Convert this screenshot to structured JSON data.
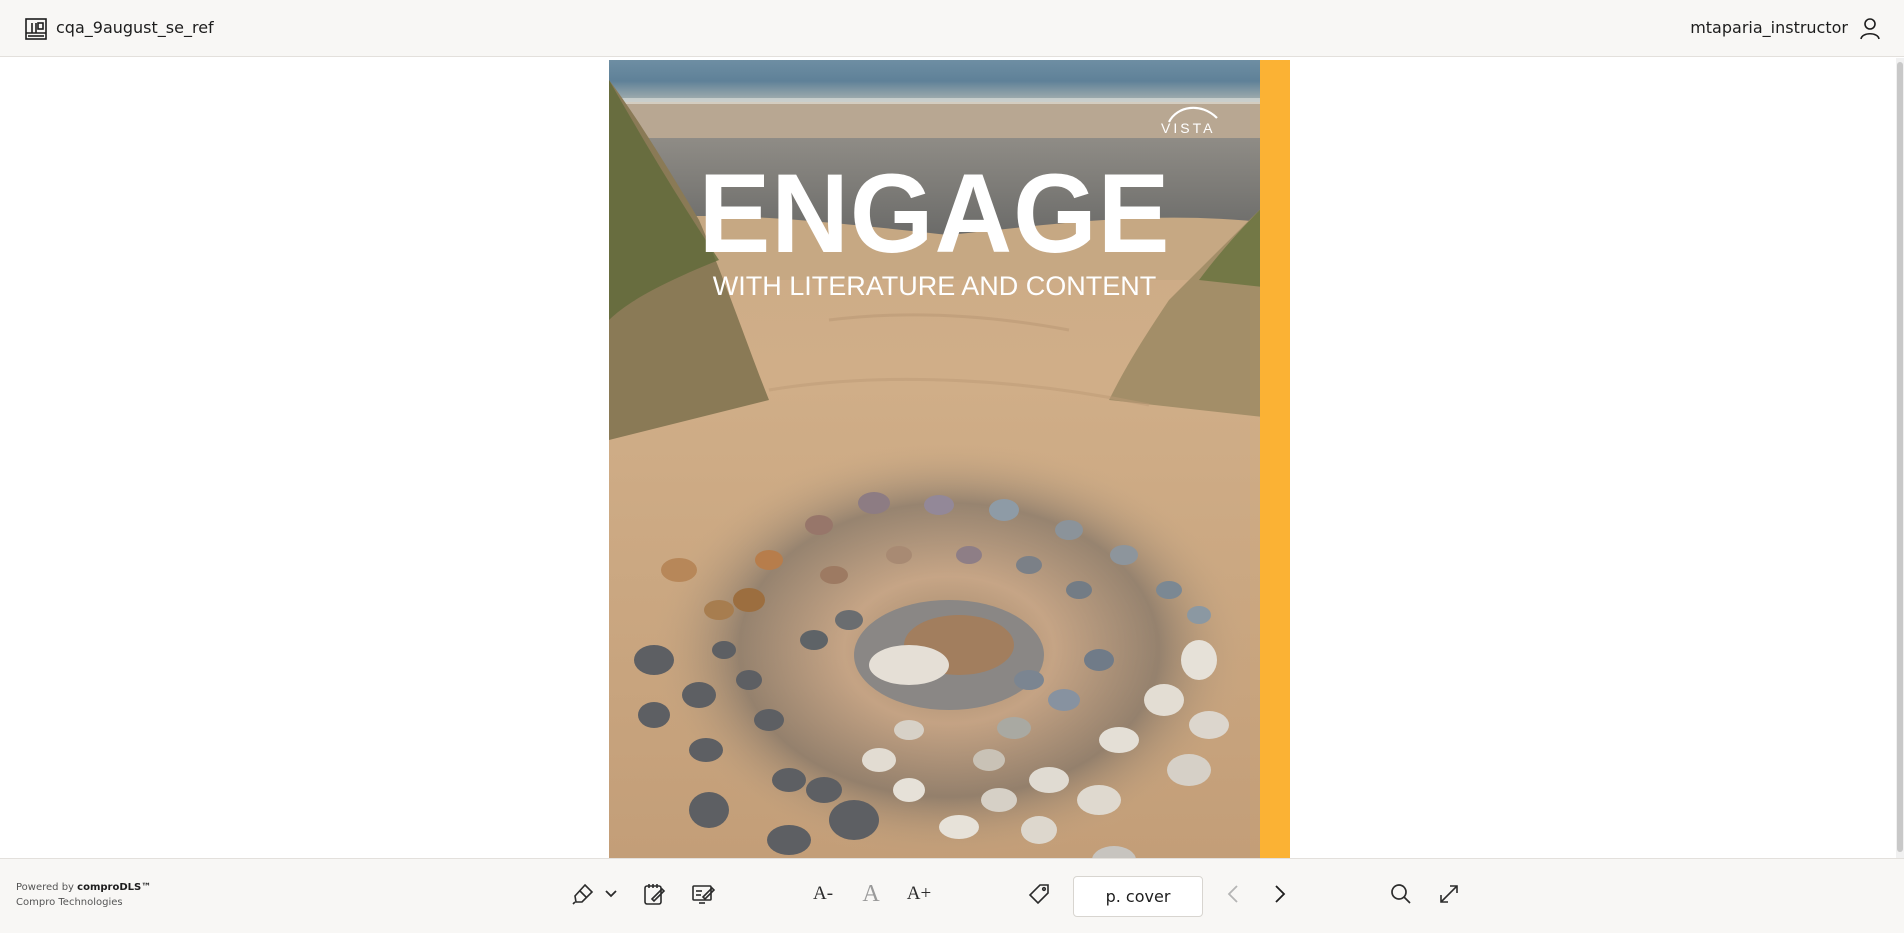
{
  "header": {
    "book_icon": "book-grid-icon",
    "book_title": "cqa_9august_se_ref",
    "user_name": "mtaparia_instructor",
    "user_icon": "user-icon"
  },
  "cover": {
    "publisher": "VISTA",
    "title": "ENGAGE",
    "subtitle": "WITH LITERATURE AND CONTENT",
    "spine_color": "#fbb234"
  },
  "footer": {
    "powered_prefix": "Powered by ",
    "powered_brand": "comproDLS™",
    "company": "Compro Technologies",
    "tools": {
      "highlighter": "highlighter-pen-icon",
      "highlighter_menu": "chevron-down-icon",
      "notes": "notepad-icon",
      "annotations": "annotations-icon",
      "font_decrease": "A-",
      "font_reset": "A",
      "font_increase": "A+",
      "bookmark": "bookmark-tag-icon",
      "page_label": "p. cover",
      "prev": "chevron-left-icon",
      "next": "chevron-right-icon",
      "search": "search-icon",
      "fullscreen": "expand-icon"
    }
  }
}
